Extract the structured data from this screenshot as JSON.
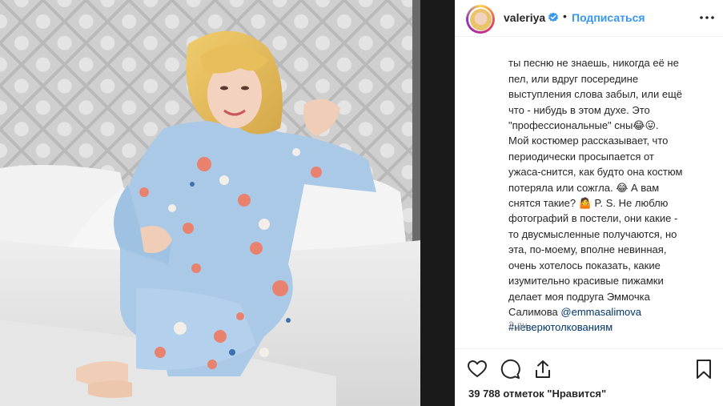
{
  "post": {
    "username": "valeriya",
    "separator": "•",
    "subscribe_label": "Подписаться",
    "caption_lines": [
      "ты песню не знаешь, никогда её не",
      "пел, или вдруг посередине",
      "выступления слова забыл, или ещё",
      "что - нибудь в этом духе. Это",
      "\"профессиональные\" сны😂😛.",
      "Мой костюмер рассказывает, что",
      "периодически просыпается от",
      "ужаса-снится, как будто она костюм",
      "потеряла или сожгла. 😂 А вам",
      "снятся такие? 🤷 P. S. Не люблю",
      "фотографий в постели, они какие -",
      "то двусмысленные получаются, но",
      "эта, по-моему, вполне невинная,",
      "очень хотелось показать, какие",
      "изумительно красивые пижамки",
      "делает моя подруга Эммочка",
      "Салимова "
    ],
    "mention": "@emmasalimova",
    "hashtag": "#неверютолкованиям",
    "timestamp": "2 дн.",
    "likes_text": "39 788 отметок \"Нравится\""
  },
  "icons": {
    "verified": "verified-badge-icon",
    "more": "more-options-icon",
    "like": "heart-icon",
    "comment": "comment-icon",
    "share": "share-icon",
    "save": "bookmark-icon"
  },
  "colors": {
    "accent": "#3897f0",
    "link": "#003569",
    "text": "#262626",
    "muted": "#999999",
    "border": "#efefef"
  }
}
